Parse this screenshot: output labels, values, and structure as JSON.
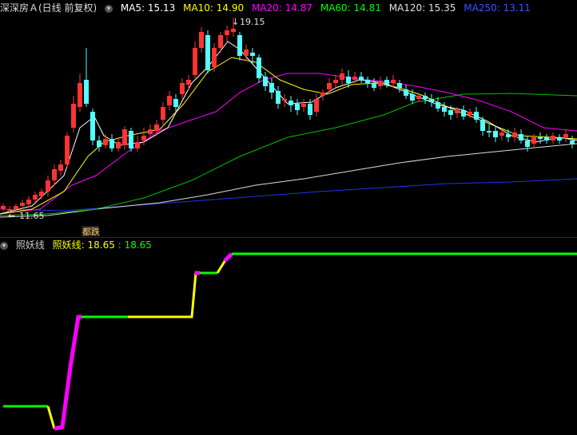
{
  "stock": {
    "name": "深深房Ａ(日线 前复权)",
    "menu_icon": "chevron-down-icon"
  },
  "ma": [
    {
      "label": "MA5: 15.13",
      "color": "#ffffff"
    },
    {
      "label": "MA10: 14.90",
      "color": "#ffff00"
    },
    {
      "label": "MA20: 14.87",
      "color": "#ff00ff"
    },
    {
      "label": "MA60: 14.81",
      "color": "#00ff00"
    },
    {
      "label": "MA120: 15.35",
      "color": "#e0e0e0"
    },
    {
      "label": "MA250: 13.11",
      "color": "#3355ff"
    }
  ],
  "annotations": {
    "high": "19.15",
    "low": "11.65",
    "badge": "都跌"
  },
  "indicator": {
    "name": "照妖线",
    "series_label": "照妖线: 18.65",
    "series_value": ": 18.65"
  },
  "colors": {
    "up": "#ff3333",
    "down": "#54ffff",
    "indicator_green": "#00ff00",
    "indicator_magenta": "#ff00ff",
    "indicator_yellow": "#ffff00"
  }
}
